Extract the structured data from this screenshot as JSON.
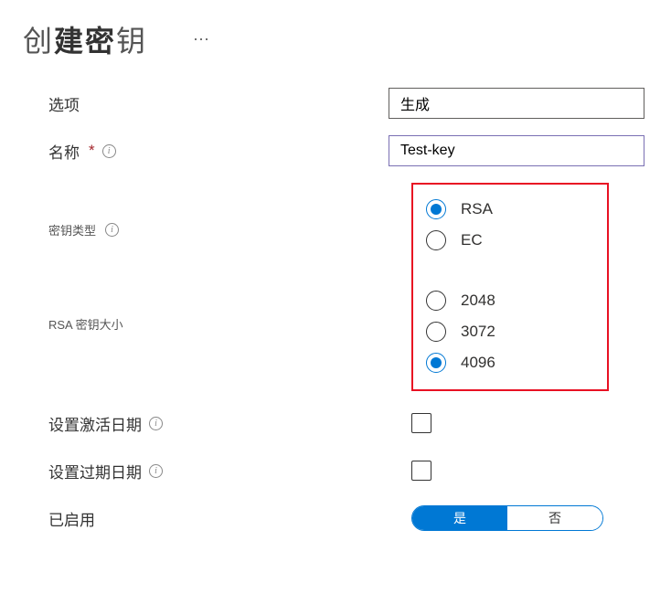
{
  "header": {
    "title_prefix": "创",
    "title_bold": "建密",
    "title_suffix": "钥"
  },
  "options": {
    "label": "选项",
    "select_value": "生成"
  },
  "name": {
    "label": "名称",
    "value": "Test-key"
  },
  "keyType": {
    "label": "密钥类型",
    "items": [
      {
        "label": "RSA",
        "selected": true
      },
      {
        "label": "EC",
        "selected": false
      }
    ]
  },
  "keySize": {
    "label": "RSA 密钥大小",
    "items": [
      {
        "label": "2048",
        "selected": false
      },
      {
        "label": "3072",
        "selected": false
      },
      {
        "label": "4096",
        "selected": true
      }
    ]
  },
  "activation": {
    "label": "设置激活日期",
    "checked": false
  },
  "expiration": {
    "label": "设置过期日期",
    "checked": false
  },
  "enabled": {
    "label": "已启用",
    "yes": "是",
    "no": "否",
    "value": true
  }
}
